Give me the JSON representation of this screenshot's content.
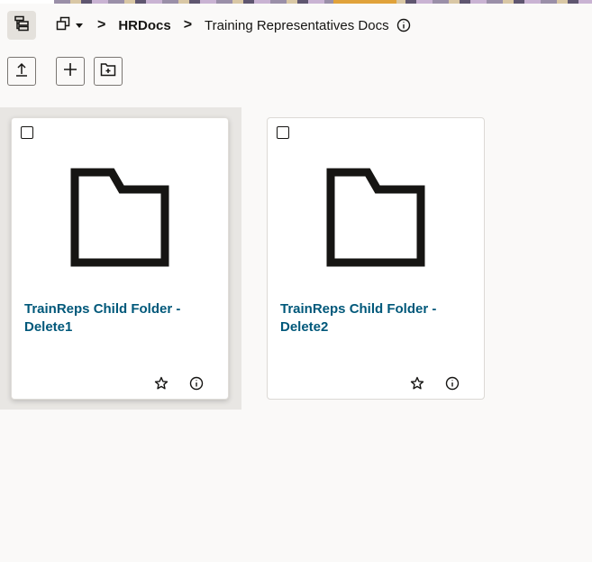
{
  "breadcrumb": {
    "separator": ">",
    "items": [
      "HRDocs",
      "Training Representatives Docs"
    ]
  },
  "icons": {
    "tree": "hierarchy-tree-icon",
    "workspace": "workspace-menu-icon",
    "info": "info-icon",
    "upload": "upload-icon",
    "add": "plus-icon",
    "new_folder": "new-folder-icon",
    "folder": "folder-icon",
    "favorite": "star-icon"
  },
  "colors": {
    "link": "#00587a",
    "selected_bg": "#e8e6e3"
  },
  "cards": [
    {
      "title": "TrainReps Child Folder - Delete1",
      "selected": true
    },
    {
      "title": "TrainReps Child Folder - Delete2",
      "selected": false
    }
  ]
}
